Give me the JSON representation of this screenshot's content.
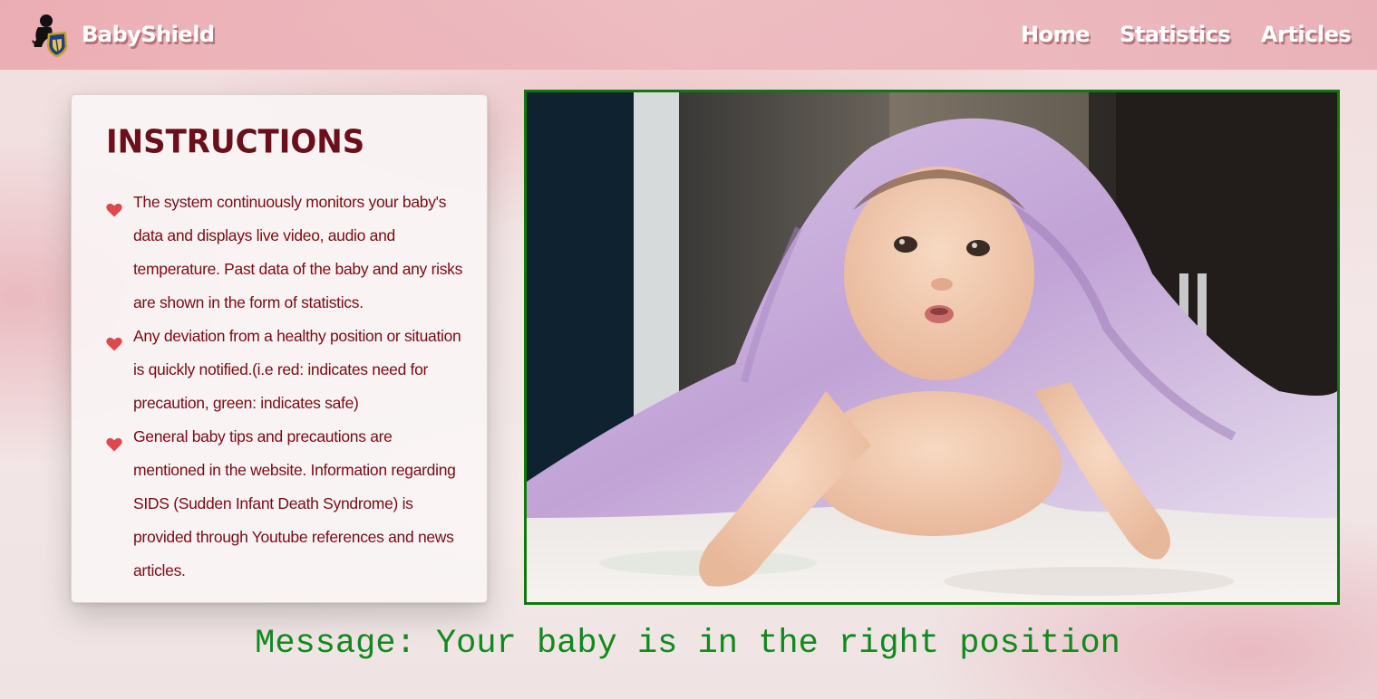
{
  "header": {
    "brand": "BabyShield",
    "logo_icon": "baby-shield-logo-icon",
    "nav": {
      "home": "Home",
      "statistics": "Statistics",
      "articles": "Articles"
    }
  },
  "instructions": {
    "title": "Instructions",
    "bullet_icon": "heart-icon",
    "bullet_color": "#e0474c",
    "items": [
      "The system continuously monitors your baby's data and displays live video, audio and temperature. Past data of the baby and any risks are shown in the form of statistics.",
      "Any deviation from a healthy position or situation is quickly notified.(i.e red: indicates need for precaution, green: indicates safe)",
      "General baby tips and precautions are mentioned in the website. Information regarding SIDS (Sudden Infant Death Syndrome) is provided through Youtube references and news articles."
    ]
  },
  "video": {
    "frame_color": "#0e7a0e"
  },
  "status": {
    "message": "Message: Your baby is in the right position",
    "color": "#118a1c"
  }
}
